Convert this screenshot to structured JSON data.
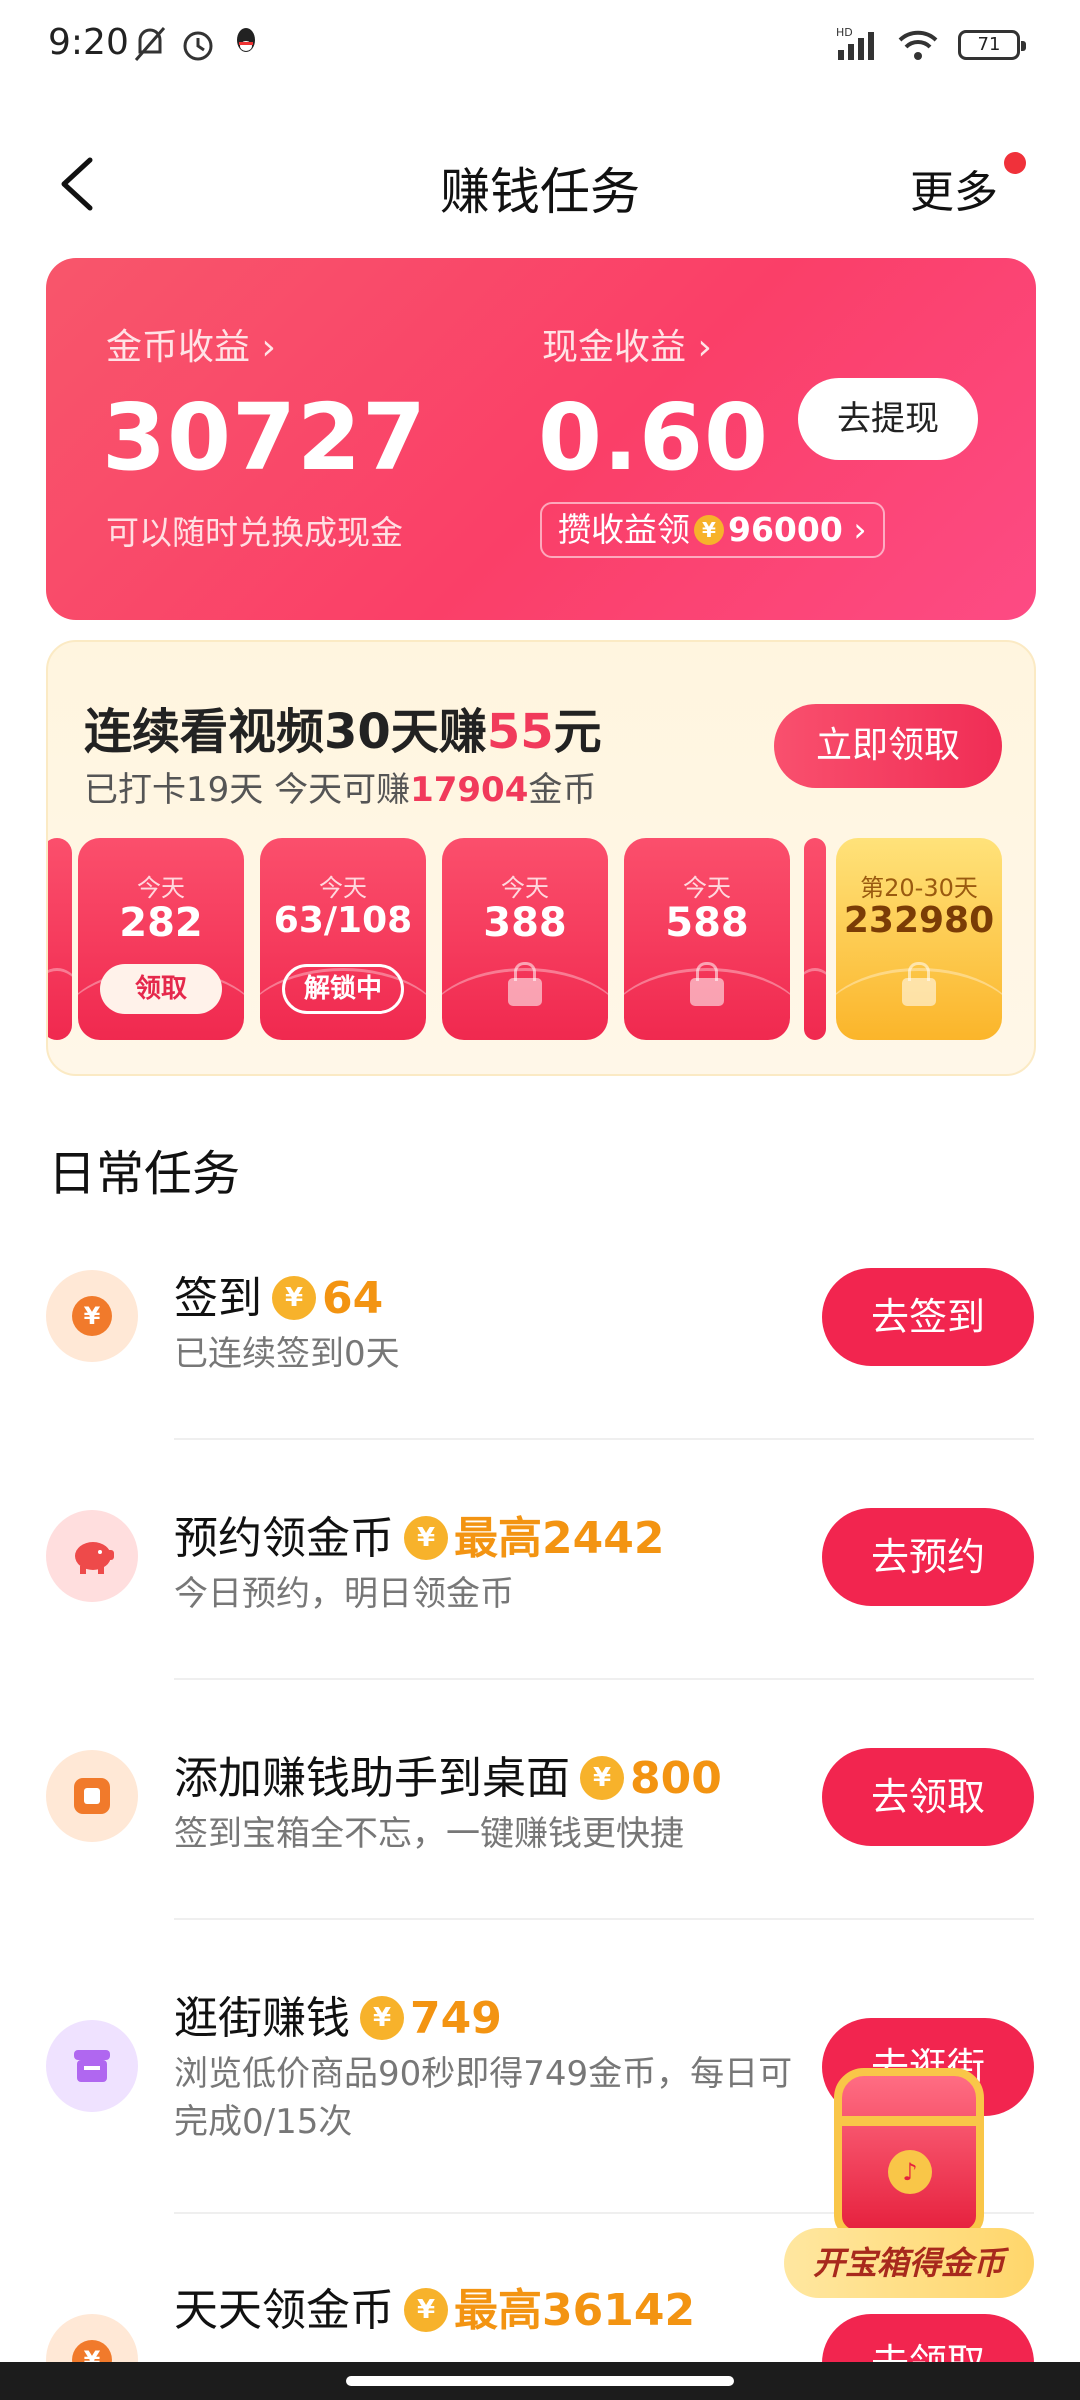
{
  "status_bar": {
    "time": "9:20",
    "battery": "71",
    "icons": [
      "mute-icon",
      "alarm-icon",
      "qq-icon",
      "hd-signal-icon",
      "wifi-icon",
      "battery-icon"
    ]
  },
  "nav": {
    "title": "赚钱任务",
    "more_label": "更多"
  },
  "earnings": {
    "coin_label": "金币收益 ›",
    "coin_value": "30727",
    "coin_sub": "可以随时兑换成现金",
    "cash_label": "现金收益 ›",
    "cash_value": "0.60",
    "withdraw_label": "去提现",
    "cash_pill_prefix": "攒收益领",
    "cash_pill_amount": "96000",
    "cash_pill_arrow": "›"
  },
  "streak": {
    "title_prefix": "连续看视频30天赚",
    "title_amount": "55",
    "title_suffix": "元",
    "sub_prefix": "已打卡19天 今天可赚",
    "sub_amount": "17904",
    "sub_suffix": "金币",
    "claim_label": "立即领取",
    "days": [
      {
        "label": "今天",
        "value": "282",
        "button": "领取"
      },
      {
        "label": "今天",
        "value": "63/108",
        "button": "解锁中"
      },
      {
        "label": "今天",
        "value": "388"
      },
      {
        "label": "今天",
        "value": "588"
      },
      {
        "label": "第20-30天",
        "value": "232980"
      }
    ]
  },
  "daily": {
    "section_title": "日常任务",
    "tasks": [
      {
        "title": "签到",
        "reward": "64",
        "desc": "已连续签到0天",
        "button": "去签到",
        "icon": "yuan-coin-icon"
      },
      {
        "title": "预约领金币",
        "reward": "最高2442",
        "desc": "今日预约，明日领金币",
        "button": "去预约",
        "icon": "piggy-bank-icon"
      },
      {
        "title": "添加赚钱助手到桌面",
        "reward": "800",
        "desc": "签到宝箱全不忘，一键赚钱更快捷",
        "button": "去领取",
        "icon": "widget-icon"
      },
      {
        "title": "逛街赚钱",
        "reward": "749",
        "desc": "浏览低价商品90秒即得749金币，每日可完成0/15次",
        "button": "去逛街",
        "icon": "shop-icon"
      },
      {
        "title": "天天领金币",
        "reward": "最高36142",
        "desc": "",
        "button": "去领取",
        "icon": "yuan-coin-icon"
      }
    ]
  },
  "treasure": {
    "label": "开宝箱得金币"
  },
  "colors": {
    "accent": "#f2254f",
    "reward": "#f39412",
    "card_gradient_start": "#f8566b",
    "card_gradient_end": "#fd4b84"
  }
}
